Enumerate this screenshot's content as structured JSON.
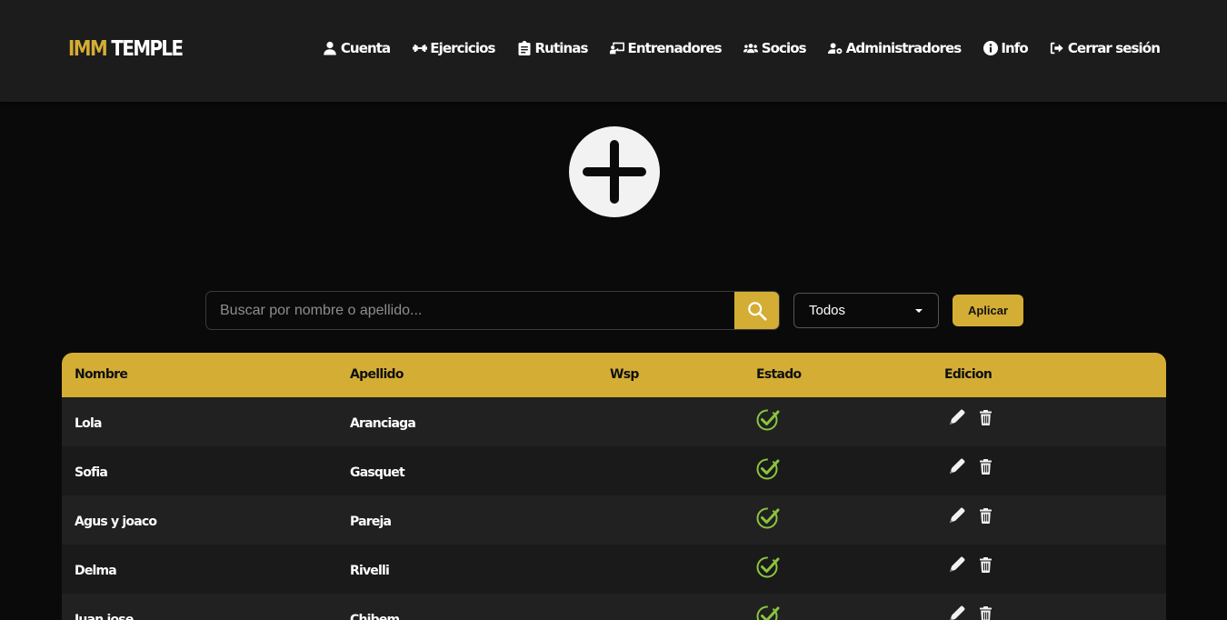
{
  "brand": {
    "part1": "IMM",
    "part2": "TEMPLE"
  },
  "nav": {
    "items": [
      {
        "label": "Cuenta",
        "icon": "user-icon"
      },
      {
        "label": "Ejercicios",
        "icon": "dumbbell-icon"
      },
      {
        "label": "Rutinas",
        "icon": "clipboard-icon"
      },
      {
        "label": "Entrenadores",
        "icon": "chalkboard-teacher-icon"
      },
      {
        "label": "Socios",
        "icon": "users-icon"
      },
      {
        "label": "Administradores",
        "icon": "user-gear-icon"
      },
      {
        "label": "Info",
        "icon": "info-circle-icon"
      },
      {
        "label": "Cerrar sesión",
        "icon": "sign-out-icon"
      }
    ]
  },
  "add_button": {
    "icon": "plus-icon"
  },
  "search": {
    "placeholder": "Buscar por nombre o apellido...",
    "value": "",
    "button_icon": "search-icon"
  },
  "filter": {
    "selected": "Todos"
  },
  "apply_label": "Aplicar",
  "table": {
    "headers": [
      "Nombre",
      "Apellido",
      "Wsp",
      "Estado",
      "Edicion"
    ],
    "rows": [
      {
        "nombre": "Lola",
        "apellido": "Aranciaga",
        "wsp": "",
        "estado": "check-icon"
      },
      {
        "nombre": "Sofia",
        "apellido": "Gasquet",
        "wsp": "",
        "estado": "check-icon"
      },
      {
        "nombre": "Agus y joaco",
        "apellido": "Pareja",
        "wsp": "",
        "estado": "check-icon"
      },
      {
        "nombre": "Delma",
        "apellido": "Rivelli",
        "wsp": "",
        "estado": "check-icon"
      },
      {
        "nombre": "Juan jose",
        "apellido": "Chibem",
        "wsp": "",
        "estado": "check-icon"
      }
    ]
  },
  "colors": {
    "accent": "#d4ad35",
    "nav_bg": "#1c1c1c",
    "page_bg": "#0a0a0a",
    "check": "#8bc53f"
  }
}
